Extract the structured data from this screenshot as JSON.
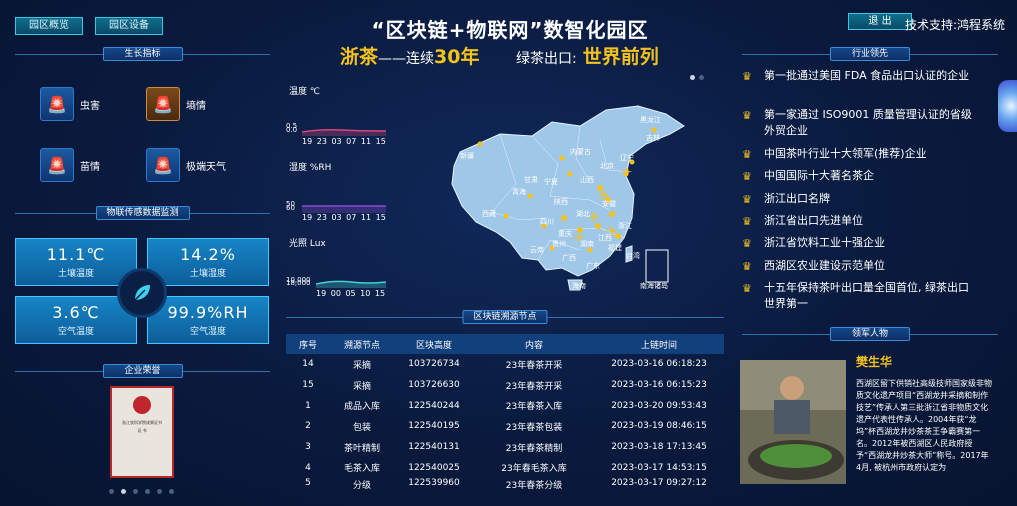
{
  "header": {
    "tabs": [
      "园区概览",
      "园区设备"
    ],
    "title": "“区块链+物联网”数智化园区",
    "slogan_brand": "浙茶",
    "slogan_mid": "——连续",
    "slogan_num": "30年",
    "slogan_export": "绿茶出口:",
    "slogan_rank": "世界前列",
    "exit_label": "退 出",
    "support": "技术支持:鸿程系统"
  },
  "growth": {
    "title": "生长指标",
    "items": [
      {
        "label": "虫害",
        "icon": "siren-icon"
      },
      {
        "label": "墒情",
        "icon": "siren-icon"
      },
      {
        "label": "苗情",
        "icon": "siren-icon"
      },
      {
        "label": "极端天气",
        "icon": "siren-icon"
      }
    ]
  },
  "sensors": {
    "title": "物联传感数据监测",
    "tiles": [
      {
        "value": "11.1℃",
        "label": "土壤温度"
      },
      {
        "value": "14.2%",
        "label": "土壤湿度"
      },
      {
        "value": "3.6℃",
        "label": "空气温度"
      },
      {
        "value": "99.9%RH",
        "label": "空气湿度"
      }
    ]
  },
  "honors": {
    "title": "企业荣誉",
    "cert_line1": "浙江农科学院成果证书",
    "cert_line2": "证 书"
  },
  "charts": {
    "temp": {
      "title": "温度 ℃",
      "ymin": "0.5",
      "ymax": "0.0",
      "ticks": "19 23 03 07 11 15"
    },
    "humidity": {
      "title": "湿度 %RH",
      "ymin": "50",
      "ymax": "60",
      "ticks": "19 23 03 07 11 15"
    },
    "light": {
      "title": "光照 Lux",
      "ymin": "10,000",
      "ymax": "18,000",
      "ticks": "19 00 05 10 15"
    }
  },
  "map": {
    "provinces": [
      "黑龙江",
      "吉林",
      "辽宁",
      "内蒙古",
      "北京",
      "山西",
      "新疆",
      "甘肃",
      "青海",
      "宁夏",
      "陕西",
      "西藏",
      "四川",
      "重庆",
      "湖北",
      "安徽",
      "浙江",
      "云南",
      "贵州",
      "广西",
      "广东",
      "福建",
      "湖南",
      "江西",
      "台湾",
      "海南"
    ],
    "inset": "南海诸岛"
  },
  "trace": {
    "title": "区块链溯源节点",
    "columns": [
      "序号",
      "溯源节点",
      "区块高度",
      "内容",
      "上链时间"
    ],
    "rows": [
      [
        "14",
        "采摘",
        "103726734",
        "23年春茶开采",
        "2023-03-16 06:18:23"
      ],
      [
        "15",
        "采摘",
        "103726630",
        "23年春茶开采",
        "2023-03-16 06:15:23"
      ],
      [
        "1",
        "成品入库",
        "122540244",
        "23年春茶入库",
        "2023-03-20 09:53:43"
      ],
      [
        "2",
        "包装",
        "122540195",
        "23年春茶包装",
        "2023-03-19 08:46:15"
      ],
      [
        "3",
        "茶叶精制",
        "122540131",
        "23年春茶精制",
        "2023-03-18 17:13:45"
      ],
      [
        "4",
        "毛茶入库",
        "122540025",
        "23年春毛茶入库",
        "2023-03-17 14:53:15"
      ],
      [
        "5",
        "分级",
        "122539960",
        "23年春茶分级",
        "2023-03-17 09:27:12"
      ]
    ]
  },
  "industry": {
    "title": "行业领先",
    "items": [
      "第一批通过美国 FDA 食品出口认证的企业",
      "第一家通过 ISO9001 质量管理认证的省级外贸企业",
      "中国茶叶行业十大领军(推荐)企业",
      "中国国际十大著名茶企",
      "浙江出口名牌",
      "浙江省出口先进单位",
      "浙江省饮料工业十强企业",
      "西湖区农业建设示范单位",
      "十五年保持茶叶出口量全国首位, 绿茶出口世界第一"
    ]
  },
  "leader": {
    "title": "领军人物",
    "name": "樊生华",
    "bio": "西湖区留下供销社高级技师国家级非物质文化遗产项目“西湖龙井采摘和制作技艺”传承人第三批浙江省非物质文化遗产代表性传承人。2004年获“龙坞”杯西湖龙井炒茶茶王争霸赛第一名。2012年被西湖区人民政府授予“西湖龙井炒茶大师”称号。2017年4月, 被杭州市政府认定为"
  },
  "colors": {
    "accent_gold": "#f4c21b",
    "tile_blue": "#1685c6",
    "bg_dark": "#0a1a3e"
  }
}
